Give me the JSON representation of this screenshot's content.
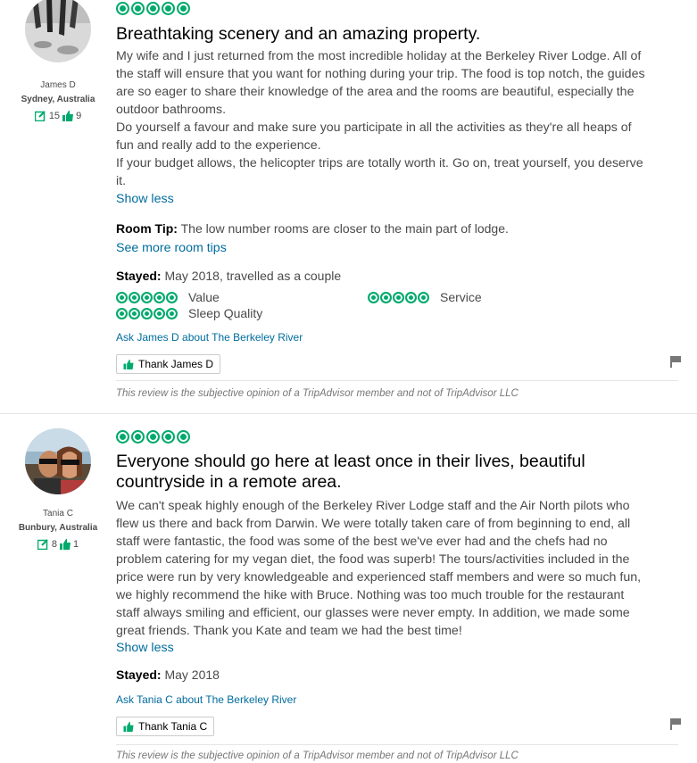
{
  "reviews": [
    {
      "user": {
        "name": "James D",
        "location": "Sydney, Australia",
        "reviews_count": "15",
        "helpful_count": "9"
      },
      "rating": 5,
      "title": "Breathtaking scenery and an amazing property.",
      "body_lines": [
        "My wife and I just returned from the most incredible holiday at the Berkeley River Lodge. All of",
        "the staff will ensure that you want for nothing during your trip. The food is top notch, the guides",
        "are so eager to share their knowledge of the area and the rooms are beautiful, especially the",
        "outdoor bathrooms.",
        "Do yourself a favour and make sure you participate in all the activities as they're all heaps of",
        "fun and really add to the experience.",
        "If your budget allows, the helicopter trips are totally worth it. Go on, treat yourself, you deserve",
        "it."
      ],
      "show_less": "Show less",
      "room_tip_label": "Room Tip:",
      "room_tip": "The low number rooms are closer to the main part of lodge.",
      "see_more_tips": "See more room tips",
      "stayed_label": "Stayed:",
      "stayed": "May 2018, travelled as a couple",
      "subratings": [
        {
          "label": "Value",
          "rating": 5
        },
        {
          "label": "Service",
          "rating": 5
        },
        {
          "label": "Sleep Quality",
          "rating": 5
        }
      ],
      "ask": "Ask James D about The Berkeley River",
      "thank": "Thank James D",
      "disclaimer": "This review is the subjective opinion of a TripAdvisor member and not of TripAdvisor LLC"
    },
    {
      "user": {
        "name": "Tania C",
        "location": "Bunbury, Australia",
        "reviews_count": "8",
        "helpful_count": "1"
      },
      "rating": 5,
      "title_lines": [
        "Everyone should go here at least once in their lives, beautiful",
        "countryside in a remote area."
      ],
      "body_lines": [
        "We can't speak highly enough of the Berkeley River Lodge staff and the Air North pilots who",
        "flew us there and back from Darwin. We were totally taken care of from beginning to end, all",
        "staff were fantastic, the food was some of the best we've ever had and the chefs had no",
        "problem catering for my vegan diet, the food was superb! The tours/activities included in the",
        "price were run by very knowledgeable and experienced staff members and were so much fun,",
        "we highly recommend the hike with Bruce. Nothing was too much trouble for the restaurant",
        "staff always smiling and efficient, our glasses were never empty. In addition, we made some",
        "great friends. Thank you Kate and team we had the best time!"
      ],
      "show_less": "Show less",
      "stayed_label": "Stayed:",
      "stayed": "May 2018",
      "ask": "Ask Tania C about The Berkeley River",
      "thank": "Thank Tania C",
      "disclaimer": "This review is the subjective opinion of a TripAdvisor member and not of TripAdvisor LLC"
    }
  ],
  "colors": {
    "bubble": "#00aa6c",
    "link": "#006c9d",
    "thumb": "#00aa6c",
    "flag": "#777777"
  }
}
